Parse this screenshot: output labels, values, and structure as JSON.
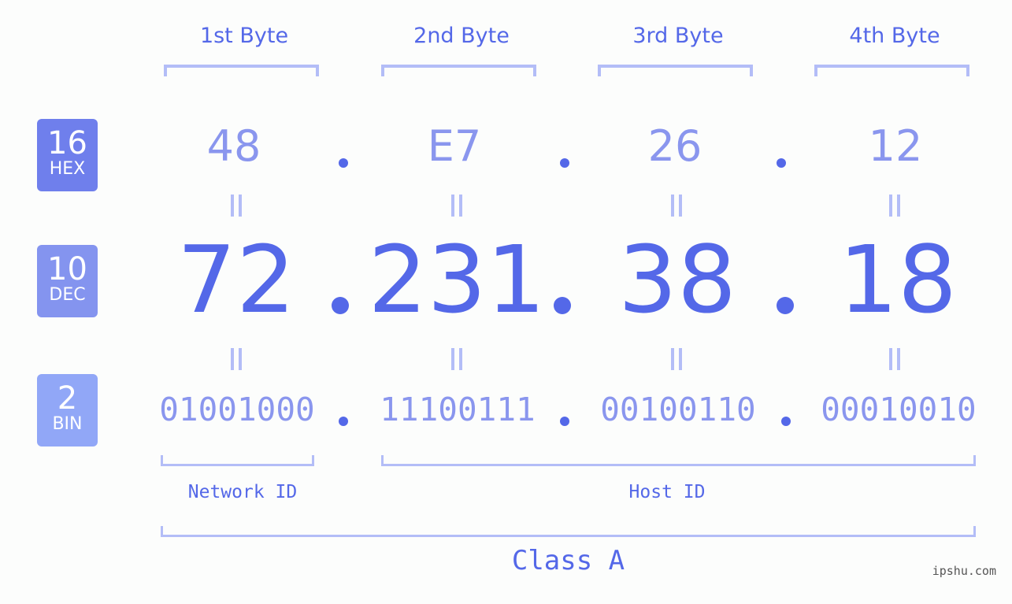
{
  "bytes": {
    "headers": [
      "1st Byte",
      "2nd Byte",
      "3rd Byte",
      "4th Byte"
    ],
    "hex": [
      "48",
      "E7",
      "26",
      "12"
    ],
    "dec": [
      "72",
      "231",
      "38",
      "18"
    ],
    "bin": [
      "01001000",
      "11100111",
      "00100110",
      "00010010"
    ]
  },
  "badges": {
    "hex": {
      "num": "16",
      "label": "HEX",
      "color": "#6f7fec"
    },
    "dec": {
      "num": "10",
      "label": "DEC",
      "color": "#8494ef"
    },
    "bin": {
      "num": "2",
      "label": "BIN",
      "color": "#91a7f7"
    }
  },
  "segments": {
    "network": "Network ID",
    "host": "Host ID",
    "class": "Class A"
  },
  "colors": {
    "accent": "#5468e8",
    "light": "#8a96ee",
    "bracket": "#b3bdf7"
  },
  "watermark": "ipshu.com"
}
